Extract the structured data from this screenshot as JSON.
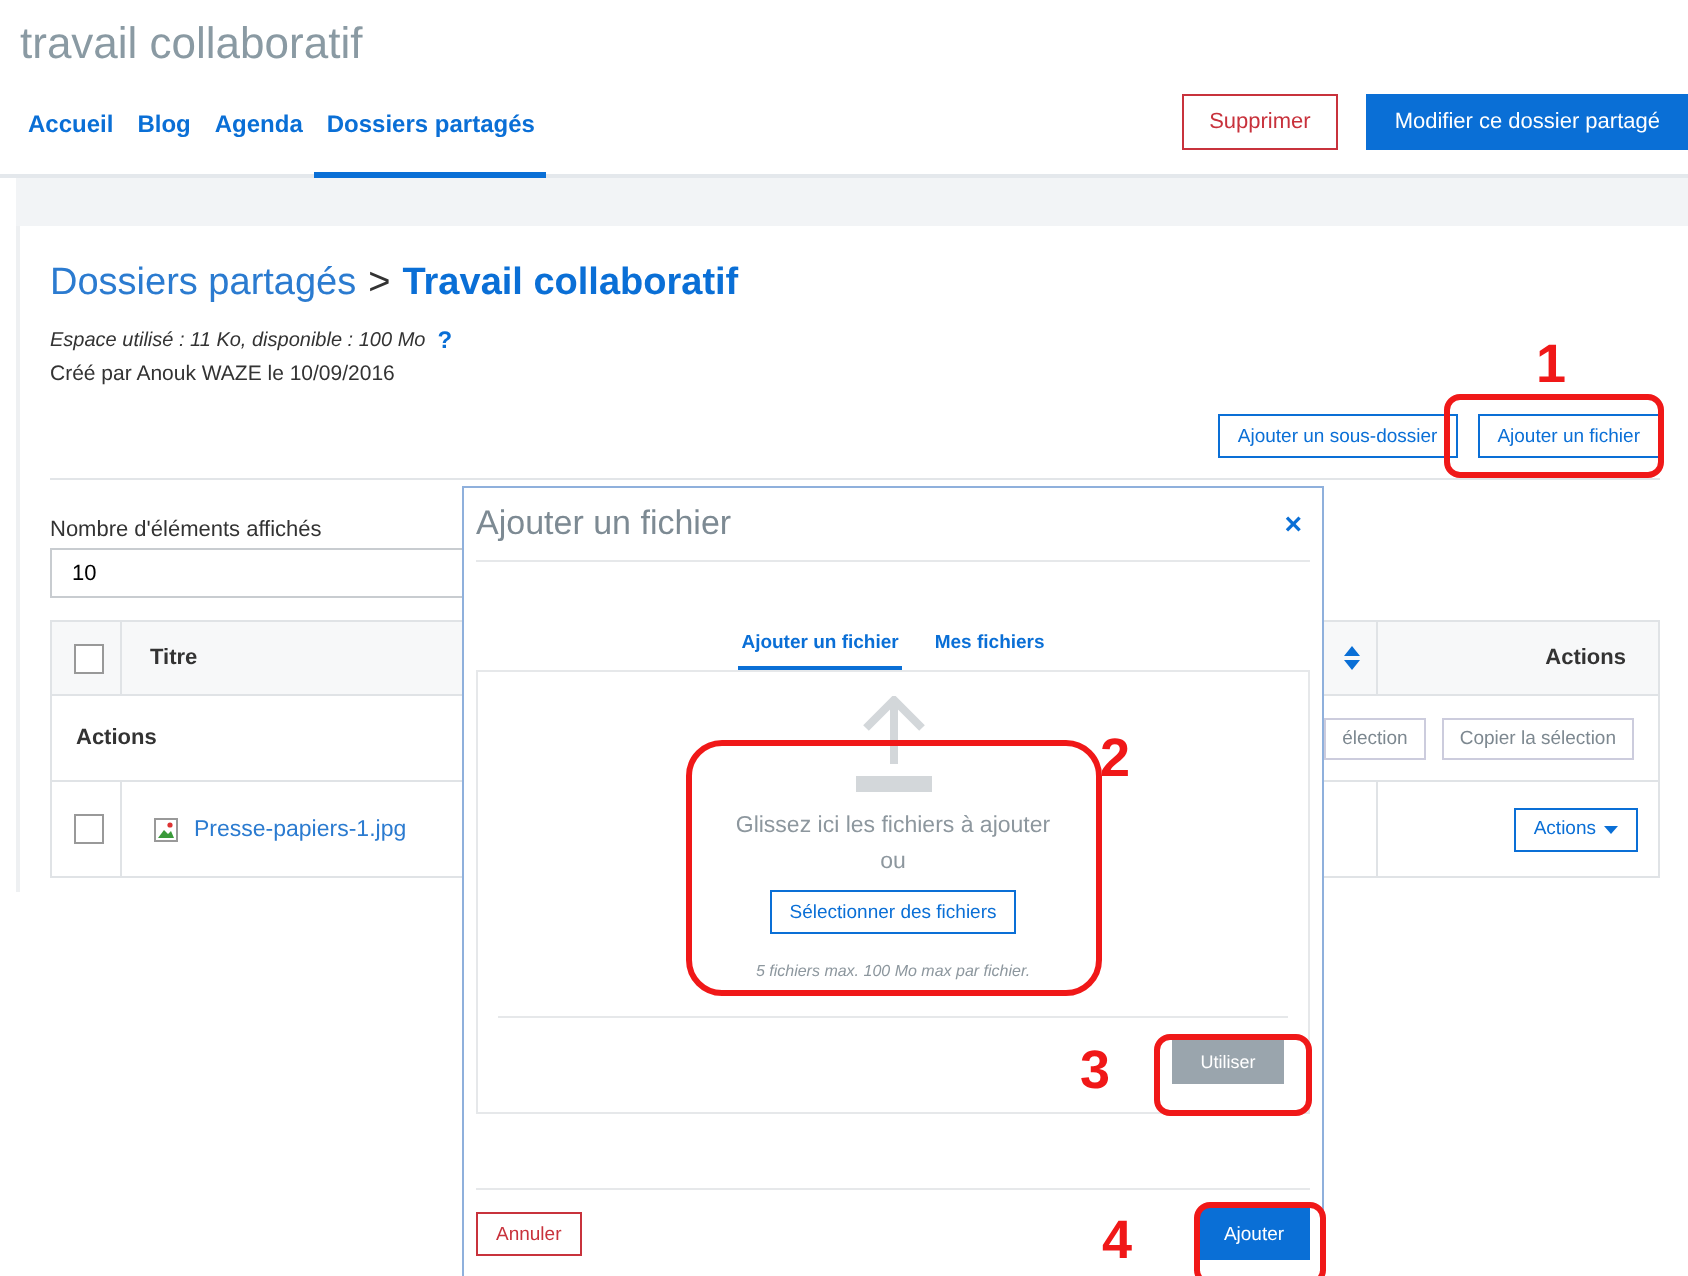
{
  "site_title": "travail collaboratif",
  "nav": {
    "tabs": [
      {
        "label": "Accueil",
        "selected": false
      },
      {
        "label": "Blog",
        "selected": false
      },
      {
        "label": "Agenda",
        "selected": false
      },
      {
        "label": "Dossiers partagés",
        "selected": true
      }
    ],
    "buttons": [
      {
        "label": "Supprimer",
        "kind": "danger"
      },
      {
        "label": "Modifier ce dossier partagé",
        "kind": "primary"
      }
    ]
  },
  "header": {
    "breadcrumb": [
      {
        "label": "Dossiers partagés",
        "current": false
      },
      {
        "label": "Travail collaboratif",
        "current": true
      }
    ],
    "separator": ">",
    "storage": "Espace utilisé : 11 Ko, disponible : 100 Mo",
    "help": "?",
    "created": "Créé par Anouk WAZE le 10/09/2016",
    "buttons": [
      "Ajouter un sous-dossier",
      "Ajouter un fichier"
    ]
  },
  "page_size": {
    "label": "Nombre d'éléments affichés",
    "value": "10"
  },
  "table": {
    "header_checked": false,
    "columns": [
      "Titre",
      "Actions"
    ],
    "actions_row": {
      "label": "Actions",
      "buttons": [
        "élection",
        "Copier la sélection"
      ]
    },
    "rows": [
      {
        "title": "Presse-papiers-1.jpg",
        "checked": false,
        "action": "Actions"
      }
    ]
  },
  "dialog": {
    "title": "Ajouter un fichier",
    "close": "×",
    "tabs": [
      {
        "label": "Ajouter un fichier",
        "selected": true
      },
      {
        "label": "Mes fichiers",
        "selected": false
      }
    ],
    "drop_text": "Glissez ici les fichiers à ajouter",
    "or": "ou",
    "select_button": "Sélectionner des fichiers",
    "limits": "5 fichiers max. 100 Mo max par fichier.",
    "use_button": {
      "label": "Utiliser",
      "disabled": true
    },
    "cancel_button": "Annuler",
    "add_button": "Ajouter"
  },
  "annotations": [
    {
      "number": "1"
    },
    {
      "number": "2"
    },
    {
      "number": "3"
    },
    {
      "number": "4"
    }
  ]
}
